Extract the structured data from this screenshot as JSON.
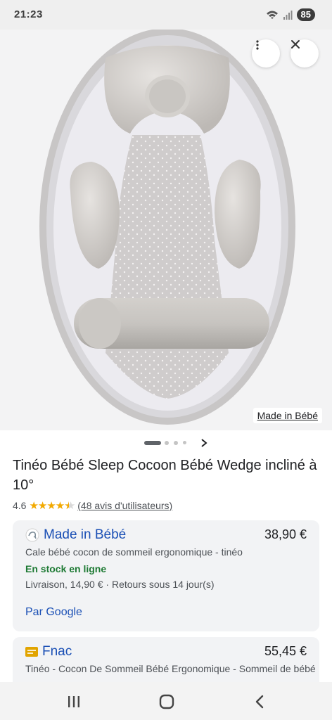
{
  "status_bar": {
    "time": "21:23",
    "battery": "85",
    "icons": [
      "wifi-icon",
      "signal-icon",
      "battery-icon"
    ]
  },
  "image_viewer": {
    "source_label": "Made in Bébé",
    "actions": [
      "more-options-icon",
      "close-icon"
    ],
    "pager": {
      "total_dots": 4,
      "active_index": 0
    }
  },
  "product": {
    "title": "Tinéo Bébé Sleep Cocoon Bébé Wedge incliné à 10°",
    "rating_value": "4.6",
    "rating_stars": 4.5,
    "reviews_text": "(48 avis d'utilisateurs)"
  },
  "offers": [
    {
      "seller": "Made in Bébé",
      "price": "38,90 €",
      "description": "Cale bébé cocon de sommeil ergonomique - tinéo",
      "stock": "En stock en ligne",
      "delivery": "Livraison, 14,90 €",
      "returns": "Retours sous 14 jour(s)",
      "by_google": "Par Google"
    },
    {
      "seller": "Fnac",
      "price": "55,45 €",
      "description": "Tinéo - Cocon De Sommeil Bébé Ergonomique - Sommeil de bébé"
    }
  ],
  "colors": {
    "link_blue": "#1a4fb5",
    "stock_green": "#1e7a34",
    "star_gold": "#f2a900",
    "card_bg": "#f2f3f5"
  },
  "nav_bar": [
    "recent-apps-icon",
    "home-icon",
    "back-icon"
  ]
}
